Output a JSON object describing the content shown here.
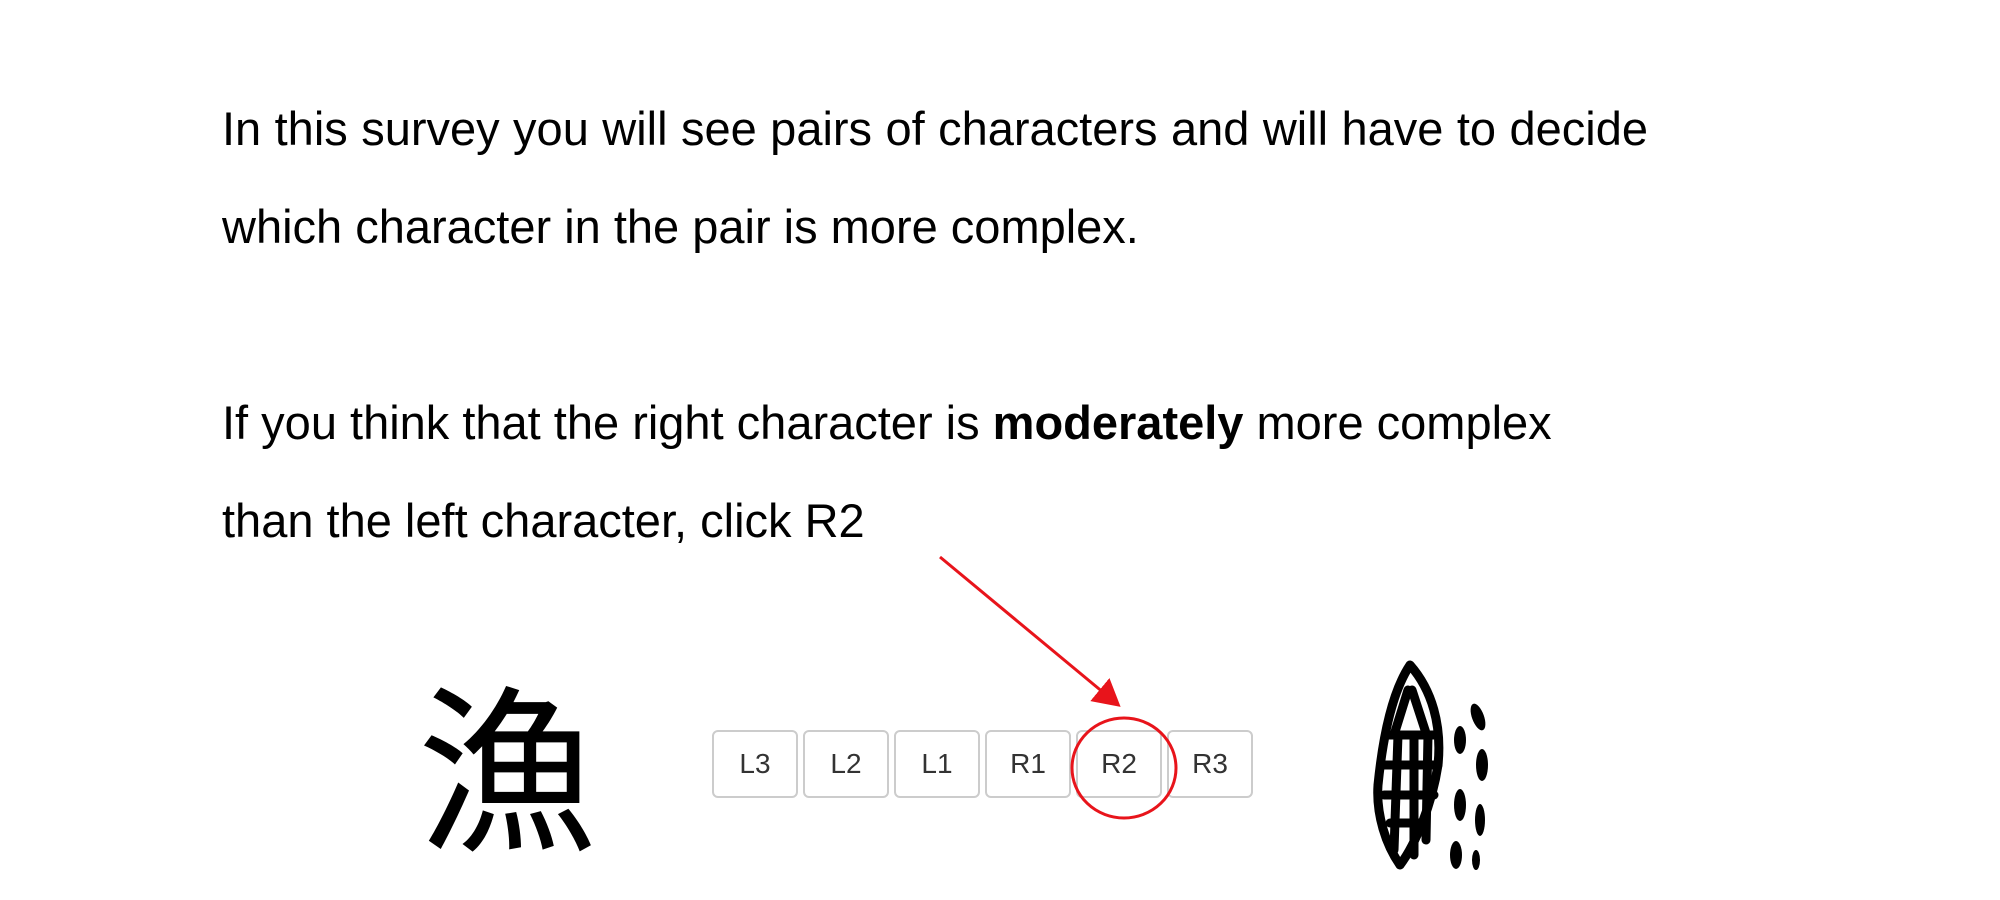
{
  "instructions": {
    "paragraph_1": "In this survey you will see pairs of characters and will have to decide which character in the pair is more complex.",
    "paragraph_2_before": "If you think that the right character is ",
    "paragraph_2_bold": "moderately",
    "paragraph_2_after": " more complex than the left character, click R2"
  },
  "left_character": "漁",
  "right_character_icon": "ancient-fish-glyph",
  "rating_buttons": [
    "L3",
    "L2",
    "L1",
    "R1",
    "R2",
    "R3"
  ],
  "highlighted_button": "R2",
  "annotation_color": "#e8141b"
}
